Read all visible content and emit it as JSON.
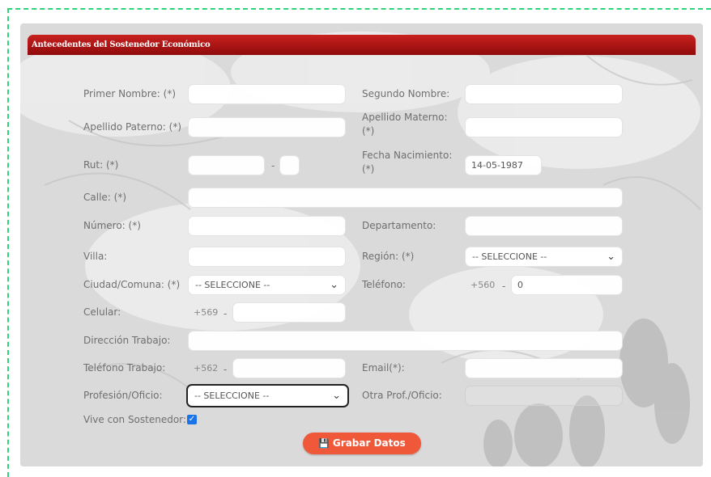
{
  "section": {
    "title": "Antecedentes del Sostenedor Económico"
  },
  "fields": {
    "primer_nombre": {
      "label": "Primer Nombre: (*)",
      "value": ""
    },
    "segundo_nombre": {
      "label": "Segundo Nombre:",
      "value": ""
    },
    "apellido_paterno": {
      "label": "Apellido Paterno: (*)",
      "value": ""
    },
    "apellido_materno": {
      "label": "Apellido Materno: (*)",
      "value": ""
    },
    "rut": {
      "label": "Rut: (*)",
      "value": "",
      "dv": ""
    },
    "fecha_nacimiento": {
      "label": "Fecha Nacimiento: (*)",
      "value": "14-05-1987"
    },
    "calle": {
      "label": "Calle: (*)",
      "value": ""
    },
    "numero": {
      "label": "Número: (*)",
      "value": ""
    },
    "departamento": {
      "label": "Departamento:",
      "value": ""
    },
    "villa": {
      "label": "Villa:",
      "value": ""
    },
    "region": {
      "label": "Región: (*)",
      "selected": "-- SELECCIONE --"
    },
    "ciudad_comuna": {
      "label": "Ciudad/Comuna: (*)",
      "selected": "-- SELECCIONE --"
    },
    "telefono": {
      "label": "Teléfono:",
      "prefix": "+560",
      "value": "0"
    },
    "celular": {
      "label": "Celular:",
      "prefix": "+569",
      "value": ""
    },
    "direccion_trabajo": {
      "label": "Dirección Trabajo:",
      "value": ""
    },
    "telefono_trabajo": {
      "label": "Teléfono Trabajo:",
      "prefix": "+562",
      "value": ""
    },
    "email": {
      "label": "Email(*):",
      "value": ""
    },
    "profesion_oficio": {
      "label": "Profesión/Oficio:",
      "selected": "-- SELECCIONE --"
    },
    "otra_profesion": {
      "label": "Otra Prof./Oficio:",
      "value": ""
    },
    "vive_con_sostenedor": {
      "label": "Vive con Sostenedor:",
      "checked": true
    }
  },
  "separator": "-",
  "icons": {
    "check": "check-icon",
    "chevron": "chevron-down-icon",
    "save": "save-icon"
  },
  "actions": {
    "save_label": "Grabar Datos"
  },
  "colors": {
    "header": "#b01414",
    "button": "#f0583a",
    "checkbox": "#1a73e8",
    "dashed_border": "#2ed47a"
  }
}
